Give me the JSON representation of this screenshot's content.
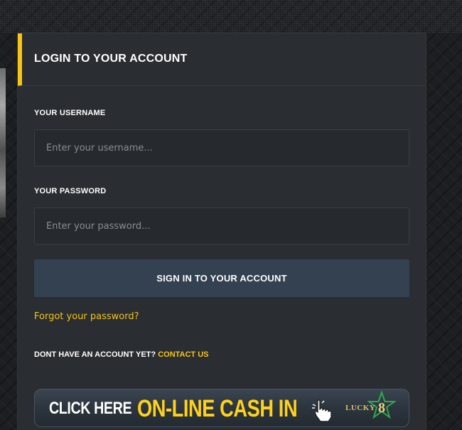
{
  "panel": {
    "title": "LOGIN TO YOUR ACCOUNT"
  },
  "username": {
    "label": "YOUR USERNAME",
    "placeholder": "Enter your username...",
    "value": ""
  },
  "password": {
    "label": "YOUR PASSWORD",
    "placeholder": "Enter your password...",
    "value": ""
  },
  "signin": {
    "label": "SIGN IN TO YOUR ACCOUNT"
  },
  "forgot": {
    "label": "Forgot your password?"
  },
  "signup": {
    "prompt": "DONT HAVE AN ACCOUNT YET?",
    "link": "CONTACT US"
  },
  "banner": {
    "click_text": "CLICK HERE",
    "cash_text": "ON-LINE CASH IN",
    "logo_text": "LUCKY",
    "logo_number": "8",
    "icon": "pointing-hand-icon"
  },
  "colors": {
    "accent": "#f5c518",
    "panel_bg": "#2a2d31",
    "button_bg": "#334150",
    "logo_green": "#2fa84f"
  }
}
